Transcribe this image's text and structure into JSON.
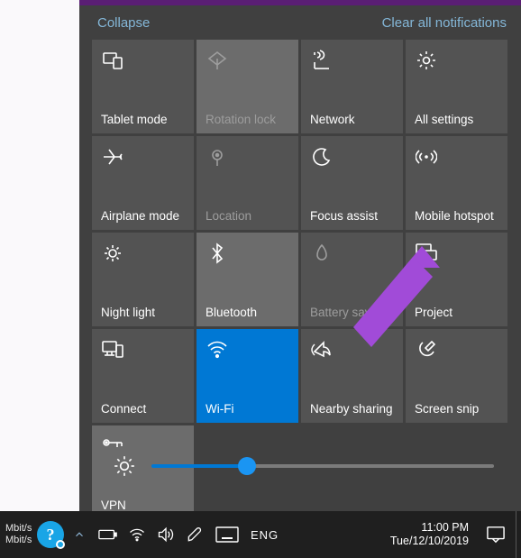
{
  "header": {
    "collapse": "Collapse",
    "clear": "Clear all notifications"
  },
  "tiles": [
    [
      {
        "id": "tablet",
        "name": "tile-tablet-mode",
        "icon": "tablet-mode-icon",
        "label": "Tablet mode",
        "state": "normal"
      },
      {
        "id": "rotation",
        "name": "tile-rotation-lock",
        "icon": "rotation-lock-icon",
        "label": "Rotation lock",
        "state": "hover disabled"
      },
      {
        "id": "network",
        "name": "tile-network",
        "icon": "network-icon",
        "label": "Network",
        "state": "normal"
      },
      {
        "id": "settings",
        "name": "tile-all-settings",
        "icon": "settings-icon",
        "label": "All settings",
        "state": "normal"
      }
    ],
    [
      {
        "id": "airplane",
        "name": "tile-airplane-mode",
        "icon": "airplane-icon",
        "label": "Airplane mode",
        "state": "normal"
      },
      {
        "id": "location",
        "name": "tile-location",
        "icon": "location-icon",
        "label": "Location",
        "state": "disabled"
      },
      {
        "id": "focus",
        "name": "tile-focus-assist",
        "icon": "moon-icon",
        "label": "Focus assist",
        "state": "normal"
      },
      {
        "id": "hotspot",
        "name": "tile-mobile-hotspot",
        "icon": "hotspot-icon",
        "label": "Mobile hotspot",
        "state": "normal"
      }
    ],
    [
      {
        "id": "night",
        "name": "tile-night-light",
        "icon": "night-light-icon",
        "label": "Night light",
        "state": "normal"
      },
      {
        "id": "bt",
        "name": "tile-bluetooth",
        "icon": "bluetooth-icon",
        "label": "Bluetooth",
        "state": "hover"
      },
      {
        "id": "battery",
        "name": "tile-battery-saver",
        "icon": "battery-saver-icon",
        "label": "Battery saver",
        "state": "disabled"
      },
      {
        "id": "project",
        "name": "tile-project",
        "icon": "project-icon",
        "label": "Project",
        "state": "normal"
      }
    ],
    [
      {
        "id": "connect",
        "name": "tile-connect",
        "icon": "connect-icon",
        "label": "Connect",
        "state": "normal"
      },
      {
        "id": "wifi",
        "name": "tile-wifi",
        "icon": "wifi-icon",
        "label": "Wi-Fi",
        "state": "active"
      },
      {
        "id": "nearby",
        "name": "tile-nearby-sharing",
        "icon": "nearby-share-icon",
        "label": "Nearby sharing",
        "state": "normal"
      },
      {
        "id": "snip",
        "name": "tile-screen-snip",
        "icon": "screen-snip-icon",
        "label": "Screen snip",
        "state": "normal"
      }
    ],
    [
      {
        "id": "vpn",
        "name": "tile-vpn",
        "icon": "vpn-icon",
        "label": "VPN",
        "state": "hover"
      }
    ]
  ],
  "brightness": {
    "value_percent": 28
  },
  "taskbar": {
    "mbit": "Mbit/s",
    "lang": "ENG",
    "time": "11:00 PM",
    "date": "Tue/12/10/2019"
  },
  "colors": {
    "accent": "#0078d4",
    "link": "#84b7d8",
    "arrow": "#a14bd8"
  }
}
